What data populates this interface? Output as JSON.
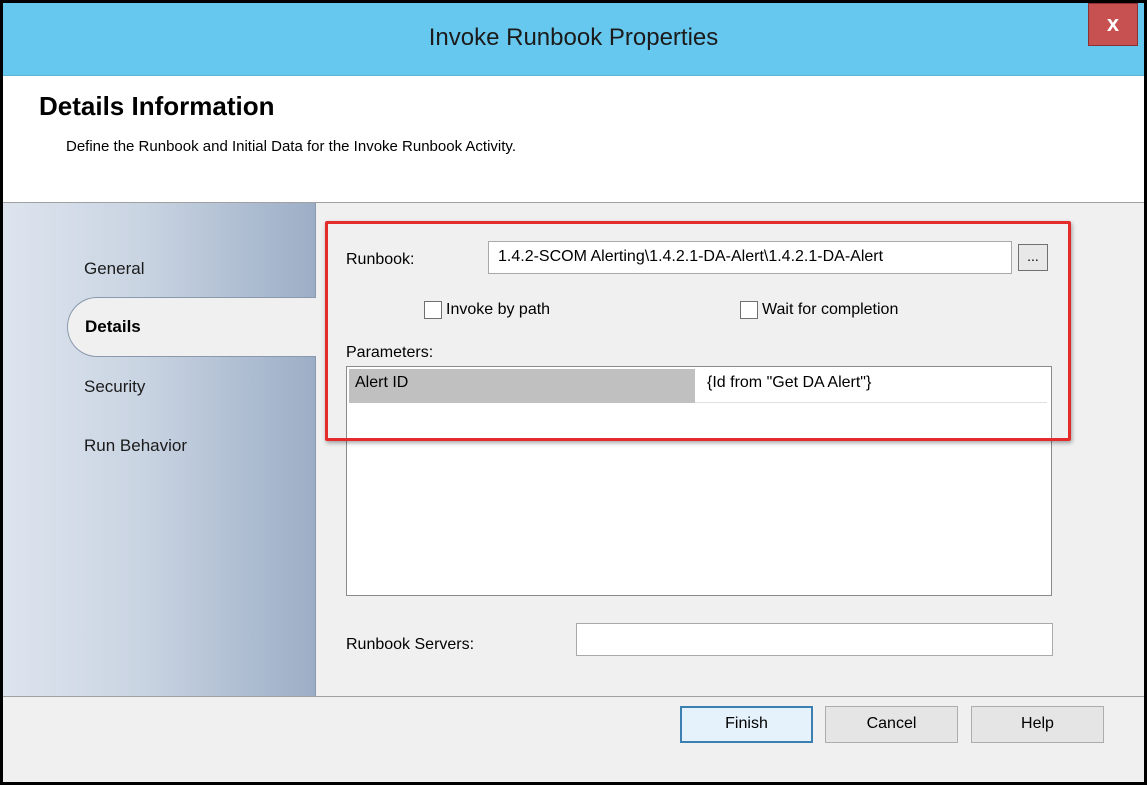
{
  "window": {
    "title": "Invoke Runbook Properties",
    "close_label": "x"
  },
  "header": {
    "title": "Details Information",
    "description": "Define the Runbook and Initial Data for the Invoke Runbook Activity."
  },
  "sidebar": {
    "items": [
      {
        "label": "General",
        "active": false
      },
      {
        "label": "Details",
        "active": true
      },
      {
        "label": "Security",
        "active": false
      },
      {
        "label": "Run Behavior",
        "active": false
      }
    ]
  },
  "details": {
    "runbook_label": "Runbook:",
    "runbook_value": "1.4.2-SCOM Alerting\\1.4.2.1-DA-Alert\\1.4.2.1-DA-Alert",
    "browse_label": "...",
    "invoke_by_path_label": "Invoke by path",
    "invoke_by_path_checked": false,
    "wait_label": "Wait for completion",
    "wait_checked": false,
    "parameters_label": "Parameters:",
    "parameters": [
      {
        "name": "Alert ID",
        "value": "{Id from \"Get DA Alert\"}"
      }
    ],
    "servers_label": "Runbook Servers:",
    "servers_value": ""
  },
  "buttons": {
    "finish": "Finish",
    "cancel": "Cancel",
    "help": "Help"
  },
  "colors": {
    "titlebar": "#67c8ef",
    "close": "#c75050",
    "highlight": "#e32b2b"
  }
}
